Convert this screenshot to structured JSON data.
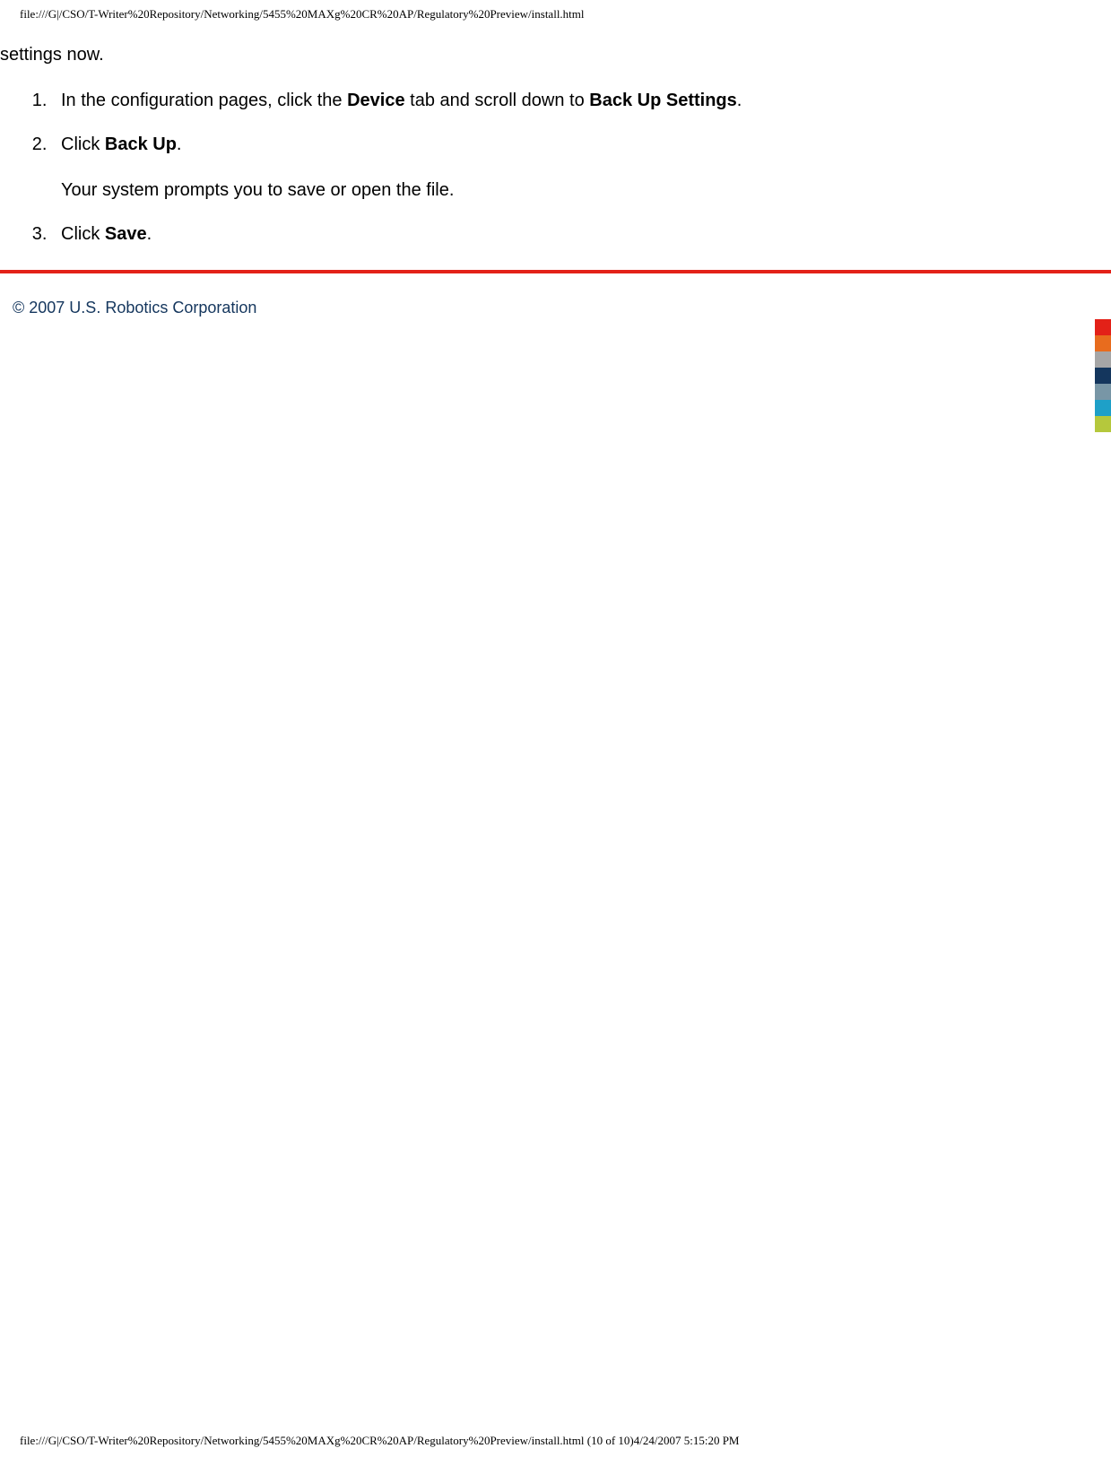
{
  "header_path": "file:///G|/CSO/T-Writer%20Repository/Networking/5455%20MAXg%20CR%20AP/Regulatory%20Preview/install.html",
  "content": {
    "intro": "settings now.",
    "steps": [
      {
        "pre1": "In the configuration pages, click the ",
        "bold1": "Device",
        "mid1": " tab and scroll down to ",
        "bold2": "Back Up Settings",
        "post1": "."
      },
      {
        "pre1": "Click ",
        "bold1": "Back Up",
        "post1": ".",
        "sub": "Your system prompts you to save or open the file."
      },
      {
        "pre1": "Click ",
        "bold1": "Save",
        "post1": "."
      }
    ]
  },
  "copyright": "© 2007 U.S. Robotics Corporation",
  "color_blocks": [
    "#e32118",
    "#e86c1e",
    "#a6a6a6",
    "#14365d",
    "#7896a6",
    "#1ea0c8",
    "#b5c83c"
  ],
  "footer_path": "file:///G|/CSO/T-Writer%20Repository/Networking/5455%20MAXg%20CR%20AP/Regulatory%20Preview/install.html (10 of 10)4/24/2007 5:15:20 PM"
}
